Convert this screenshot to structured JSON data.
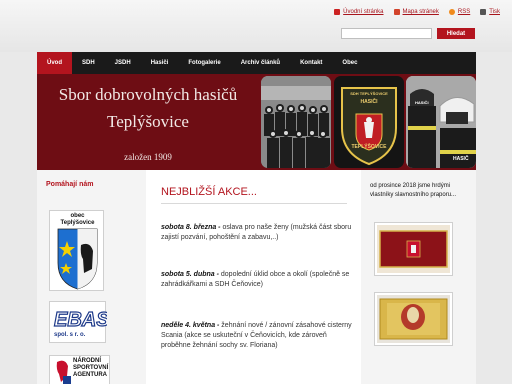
{
  "utility": {
    "links": [
      {
        "label": "Úvodní stránka",
        "icon": "home-icon"
      },
      {
        "label": "Mapa stránek",
        "icon": "sitemap-icon"
      },
      {
        "label": "RSS",
        "icon": "rss-icon"
      },
      {
        "label": "Tisk",
        "icon": "print-icon"
      }
    ],
    "search_button": "Hledat",
    "search_value": ""
  },
  "nav": {
    "items": [
      "Úvod",
      "SDH",
      "JSDH",
      "Hasiči",
      "Fotogalerie",
      "Archiv článků",
      "Kontakt",
      "Obec"
    ],
    "active": 0
  },
  "banner": {
    "title_line1": "Sbor dobrovolných hasičů",
    "title_line2": "Teplýšovice",
    "founded": "založen 1909",
    "patch_top": "SDH TEPLÝŠOVICE",
    "patch_mid": "HASIČI",
    "patch_bottom": "TEPLÝŠOVICE",
    "helmet_text": "HASIČ",
    "vest_text": "HASIČI"
  },
  "sidebar_left": {
    "title": "Pomáhají nám",
    "logos": [
      {
        "name": "obec Teplýšovice",
        "line1": "obec",
        "line2": "Teplýšovice"
      },
      {
        "name": "EBAS",
        "line1": "EBAS",
        "line2": "spol. s r. o."
      },
      {
        "name": "Národní sportovní agentura",
        "line1": "NÁRODNÍ",
        "line2": "SPORTOVNÍ",
        "line3": "AGENTURA"
      }
    ]
  },
  "main": {
    "heading": "NEJBLIŽŠÍ AKCE...",
    "events": [
      {
        "date": "sobota 8. března -",
        "text": " oslava pro naše ženy (mužská část sboru zajistí pozvání, pohoštění a zabavu,..)"
      },
      {
        "date": "sobota 5. dubna -",
        "text": " dopolední úklid obce a okolí (společně se zahrádkářkami a SDH Čeňovice)"
      },
      {
        "date": "neděle 4. května -",
        "text": " žehnání nové / zánovní zásahové cisterny Scania (akce se uskuteční v Čeňovicích, kde zároveň  proběhne žehnání sochy sv. Floriana)"
      }
    ]
  },
  "sidebar_right": {
    "text": "od prosince 2018 jsme hrdými vlastníky slavnostního praporu...",
    "flag1_text": "SBOR DOBROVOLNÝCH HASIČŮ TEPLÝŠOVICE",
    "flag2_text": ""
  },
  "colors": {
    "brand_red": "#b3141e",
    "banner_bg": "#6e0d14",
    "nav_bg": "#1a1a1a"
  }
}
